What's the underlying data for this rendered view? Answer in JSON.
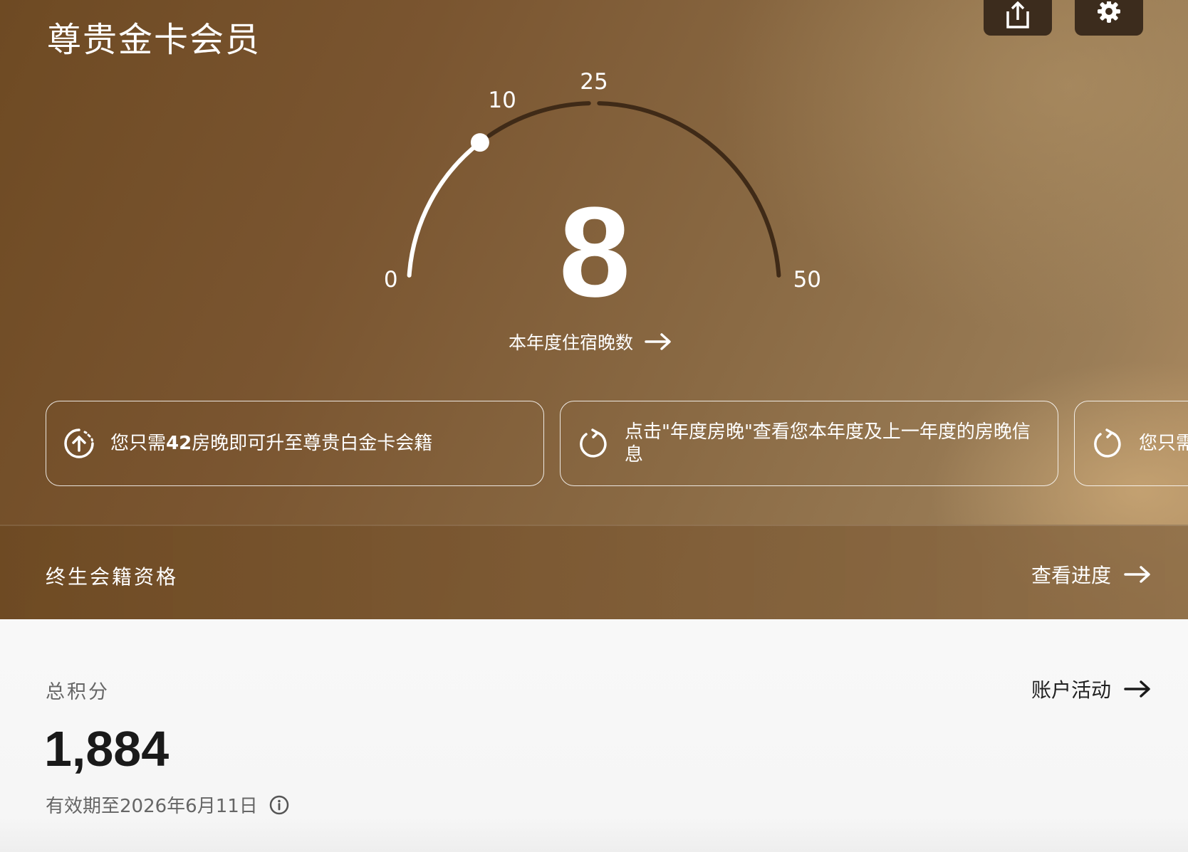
{
  "header": {
    "title": "尊贵金卡会员",
    "share_icon": "share-icon",
    "settings_icon": "gear-icon"
  },
  "gauge": {
    "current_nights": "8",
    "value": 8,
    "min": 0,
    "max": 50,
    "tick_labels": [
      "0",
      "10",
      "25",
      "50"
    ],
    "caption": "本年度住宿晚数",
    "track_color": "#3f2a17",
    "progress_color": "#ffffff"
  },
  "cards": [
    {
      "icon": "upgrade-arrow-icon",
      "text_prefix": "您只需",
      "highlight": "42",
      "text_suffix": "房晚即可升至尊贵白金卡会籍"
    },
    {
      "icon": "refresh-icon",
      "text": "点击\"年度房晚\"查看您本年度及上一年度的房晚信息"
    },
    {
      "icon": "refresh-icon",
      "text": "您只需"
    }
  ],
  "lifetime": {
    "title": "终生会籍资格",
    "link_label": "查看进度"
  },
  "points": {
    "label": "总积分",
    "value": "1,884",
    "expiry": "有效期至2026年6月11日",
    "link_label": "账户活动"
  }
}
